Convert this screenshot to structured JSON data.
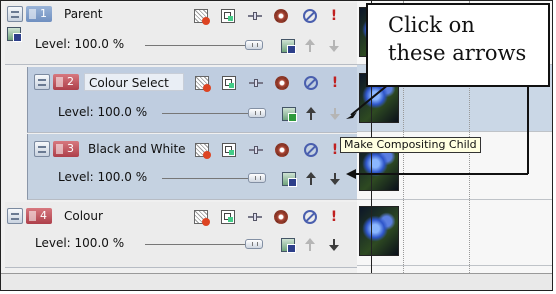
{
  "tracks": [
    {
      "number": "1",
      "name": "Parent",
      "level_text": "Level: 100.0 %",
      "level_value": 100.0,
      "kind": "parent",
      "number_color": "#7f9fcc"
    },
    {
      "number": "2",
      "name": "Colour Select",
      "level_text": "Level: 100.0 %",
      "level_value": 100.0,
      "kind": "child",
      "number_color": "#c25a63"
    },
    {
      "number": "3",
      "name": "Black and White",
      "level_text": "Level: 100.0 %",
      "level_value": 100.0,
      "kind": "child",
      "number_color": "#c25a63"
    },
    {
      "number": "4",
      "name": "Colour",
      "level_text": "Level: 100.0 %",
      "level_value": 100.0,
      "kind": "top",
      "number_color": "#c25a63"
    }
  ],
  "callout": {
    "line1": "Click on",
    "line2": "these arrows"
  },
  "tooltip": {
    "text": "Make Compositing Child"
  },
  "icons": [
    "track-fx-icon",
    "event-pan-crop-icon",
    "track-motion-icon",
    "generated-media-gear-icon",
    "mute-icon",
    "solo-icon",
    "compositing-mode-icon",
    "make-compositing-parent-arrow-icon",
    "make-compositing-child-arrow-icon"
  ],
  "colors": {
    "child_track_bg": "#c5d2e1",
    "solo_red": "#c02020",
    "mute_blue": "#4a5fae"
  }
}
